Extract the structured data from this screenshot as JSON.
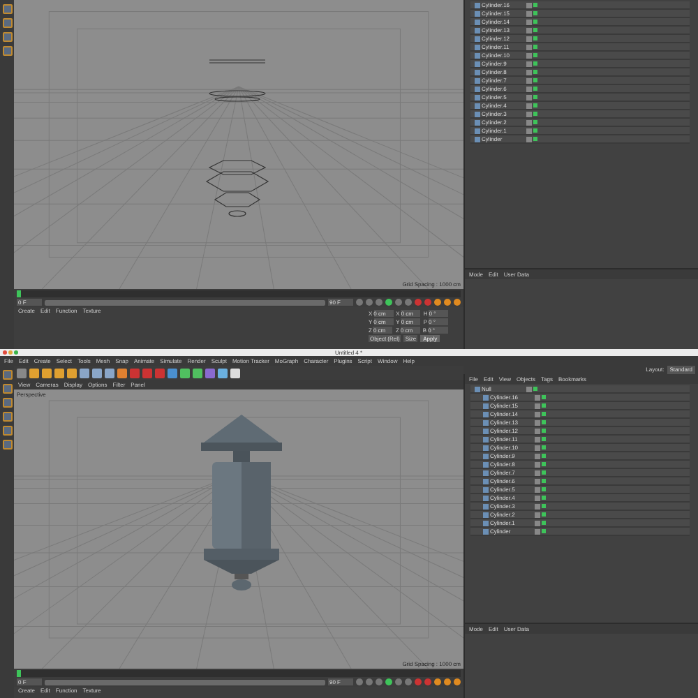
{
  "top": {
    "viewport": {
      "grid_spacing": "Grid Spacing : 1000 cm",
      "kind": "wireframe"
    },
    "timeline": {
      "start": "0 F",
      "end": "90 F",
      "level": 0.0,
      "range": {
        "level": 1.0
      }
    },
    "materials_menu": [
      "Create",
      "Edit",
      "Function",
      "Texture"
    ],
    "coords": {
      "rows": [
        {
          "label": "X",
          "value": "0 cm",
          "label2": "X",
          "value2": "0 cm",
          "label3": "H",
          "value3": "0 °"
        },
        {
          "label": "Y",
          "value": "0 cm",
          "label2": "Y",
          "value2": "0 cm",
          "label3": "P",
          "value3": "0 °"
        },
        {
          "label": "Z",
          "value": "0 cm",
          "label2": "Z",
          "value2": "0 cm",
          "label3": "B",
          "value3": "0 °"
        }
      ],
      "mode": "Object (Rel)",
      "size": "Size",
      "apply": "Apply"
    },
    "objects": [
      {
        "name": "Cylinder.16"
      },
      {
        "name": "Cylinder.15"
      },
      {
        "name": "Cylinder.14"
      },
      {
        "name": "Cylinder.13"
      },
      {
        "name": "Cylinder.12"
      },
      {
        "name": "Cylinder.11"
      },
      {
        "name": "Cylinder.10"
      },
      {
        "name": "Cylinder.9"
      },
      {
        "name": "Cylinder.8"
      },
      {
        "name": "Cylinder.7"
      },
      {
        "name": "Cylinder.6"
      },
      {
        "name": "Cylinder.5"
      },
      {
        "name": "Cylinder.4"
      },
      {
        "name": "Cylinder.3"
      },
      {
        "name": "Cylinder.2"
      },
      {
        "name": "Cylinder.1"
      },
      {
        "name": "Cylinder"
      }
    ],
    "attributes_menu": [
      "Mode",
      "Edit",
      "User Data"
    ]
  },
  "window": {
    "title": "Untitled 4 *"
  },
  "menu": [
    "File",
    "Edit",
    "Create",
    "Select",
    "Tools",
    "Mesh",
    "Snap",
    "Animate",
    "Simulate",
    "Render",
    "Sculpt",
    "Motion Tracker",
    "MoGraph",
    "Character",
    "Plugins",
    "Script",
    "Window",
    "Help"
  ],
  "bottom": {
    "viewport_menu": [
      "View",
      "Cameras",
      "Display",
      "Options",
      "Filter",
      "Panel"
    ],
    "viewport_label": "Perspective",
    "viewport": {
      "grid_spacing": "Grid Spacing : 1000 cm",
      "kind": "shaded"
    },
    "timeline": {
      "start": "0 F",
      "end": "90 F",
      "level": 0.0,
      "range": {
        "level": 1.0
      }
    },
    "materials_menu": [
      "Create",
      "Edit",
      "Function",
      "Texture"
    ],
    "objects_menu": [
      "File",
      "Edit",
      "View",
      "Objects",
      "Tags",
      "Bookmarks"
    ],
    "layout_label": "Layout:",
    "layout_value": "Standard",
    "objects": [
      {
        "name": "Null",
        "children": [
          {
            "name": "Cylinder.16"
          },
          {
            "name": "Cylinder.15"
          },
          {
            "name": "Cylinder.14"
          },
          {
            "name": "Cylinder.13"
          },
          {
            "name": "Cylinder.12"
          },
          {
            "name": "Cylinder.11"
          },
          {
            "name": "Cylinder.10"
          },
          {
            "name": "Cylinder.9"
          },
          {
            "name": "Cylinder.8"
          },
          {
            "name": "Cylinder.7"
          },
          {
            "name": "Cylinder.6"
          },
          {
            "name": "Cylinder.5"
          },
          {
            "name": "Cylinder.4"
          },
          {
            "name": "Cylinder.3"
          },
          {
            "name": "Cylinder.2"
          },
          {
            "name": "Cylinder.1"
          },
          {
            "name": "Cylinder"
          }
        ]
      }
    ],
    "attributes_menu": [
      "Mode",
      "Edit",
      "User Data"
    ]
  }
}
